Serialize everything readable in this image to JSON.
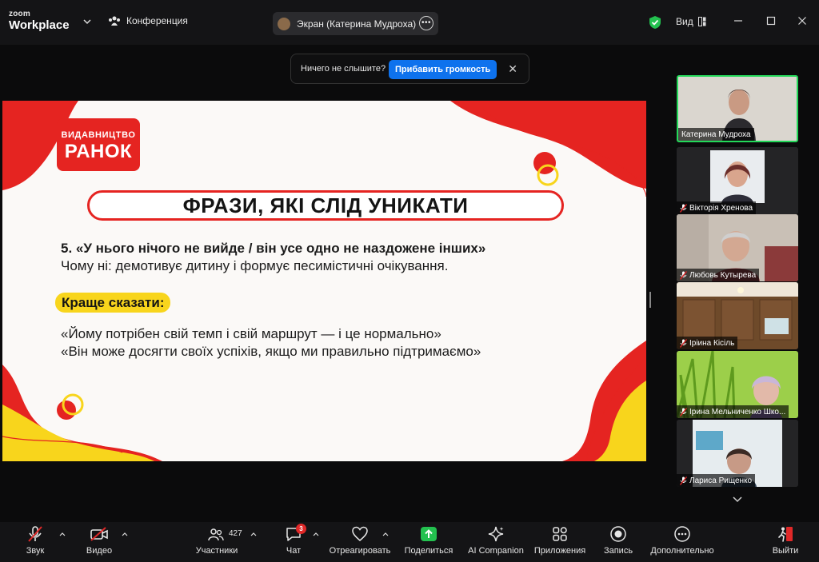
{
  "app": {
    "logo_top": "zoom",
    "logo_bottom": "Workplace"
  },
  "header": {
    "conference_label": "Конференция",
    "share_label": "Экран (Катерина Мудроха)",
    "view_label": "Вид"
  },
  "notice": {
    "text": "Ничего не слышите?",
    "button": "Прибавить громкость"
  },
  "slide": {
    "brand_top": "ВИДАВНИЦТВО",
    "brand_bottom": "РАНОК",
    "heading": "ФРАЗИ, ЯКІ СЛІД УНИКАТИ",
    "phrase": "5. «У нього нічого не вийде / він усе одно не наздожене інших»",
    "reason": "Чому ні: демотивує дитину і формує песимістичні очікування.",
    "better_label": "Краще сказати:",
    "alt1": "«Йому потрібен свій темп і свій маршрут — і це нормально»",
    "alt2": "«Він може досягти своїх успіхів, якщо ми правильно підтримаємо»",
    "colors": {
      "red": "#e52421",
      "yellow": "#f8d51c"
    }
  },
  "participants": [
    {
      "name": "Катерина Мудроха",
      "muted": false,
      "active": true
    },
    {
      "name": "Вікторія Хренова",
      "muted": true,
      "active": false
    },
    {
      "name": "Любовь Кутырева",
      "muted": true,
      "active": false
    },
    {
      "name": "Іріина Кісіль",
      "muted": true,
      "active": false
    },
    {
      "name": "Ірина Мельниченко Шко...",
      "muted": true,
      "active": false
    },
    {
      "name": "Лариса Рищенко",
      "muted": true,
      "active": false
    }
  ],
  "toolbar": {
    "audio": "Звук",
    "video": "Видео",
    "participants": "Участники",
    "participants_count": "427",
    "chat": "Чат",
    "chat_badge": "3",
    "react": "Отреагировать",
    "share": "Поделиться",
    "ai": "AI Companion",
    "apps": "Приложения",
    "record": "Запись",
    "more": "Дополнительно",
    "leave": "Выйти"
  }
}
